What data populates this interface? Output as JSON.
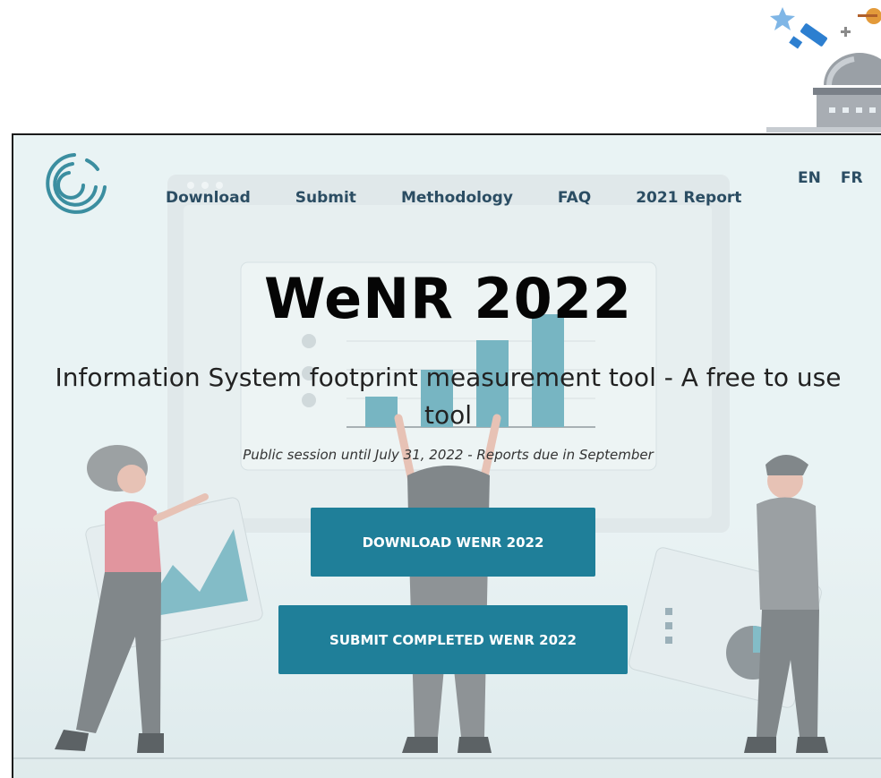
{
  "header": {
    "nav": [
      "Download",
      "Submit",
      "Methodology",
      "FAQ",
      "2021 Report"
    ],
    "languages": [
      "EN",
      "FR"
    ]
  },
  "hero": {
    "title": "WeNR 2022",
    "subtitle": "Information System footprint measurement tool - A free to use tool",
    "note": "Public session until July 31, 2022 - Reports due in September",
    "download_button": "DOWNLOAD WENR 2022",
    "submit_button": "SUBMIT COMPLETED WENR 2022"
  },
  "icons": [
    "observatory-telescope-icon",
    "site-logo-icon"
  ],
  "colors": {
    "accent": "#1f7f99",
    "nav_text": "#2b4d63",
    "background": "#eaf3f4",
    "logo": "#3b8ea0"
  }
}
